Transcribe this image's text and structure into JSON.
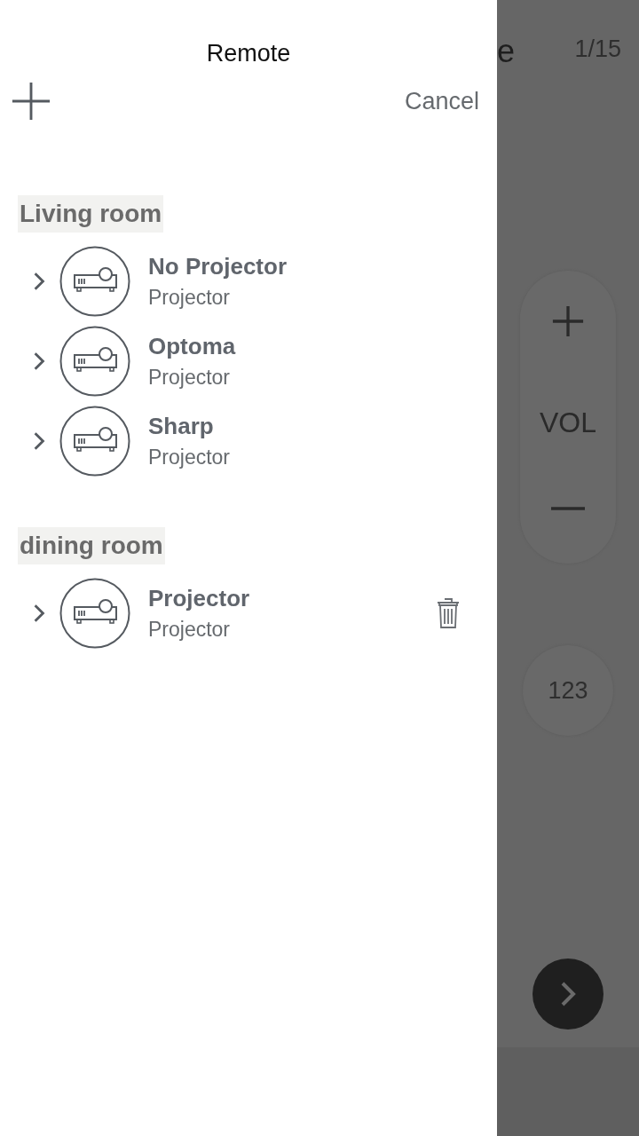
{
  "drawer": {
    "title": "Remote",
    "cancel": "Cancel",
    "groups": [
      {
        "name": "Living room",
        "devices": [
          {
            "name": "No Projector",
            "type": "Projector",
            "show_delete": false
          },
          {
            "name": "Optoma",
            "type": "Projector",
            "show_delete": false
          },
          {
            "name": "Sharp",
            "type": "Projector",
            "show_delete": false
          }
        ]
      },
      {
        "name": "dining room",
        "devices": [
          {
            "name": "Projector",
            "type": "Projector",
            "show_delete": true
          }
        ]
      }
    ]
  },
  "background": {
    "title_fragment": "e",
    "page_counter": "1/15",
    "volume_label": "VOL",
    "numpad_label": "123"
  }
}
